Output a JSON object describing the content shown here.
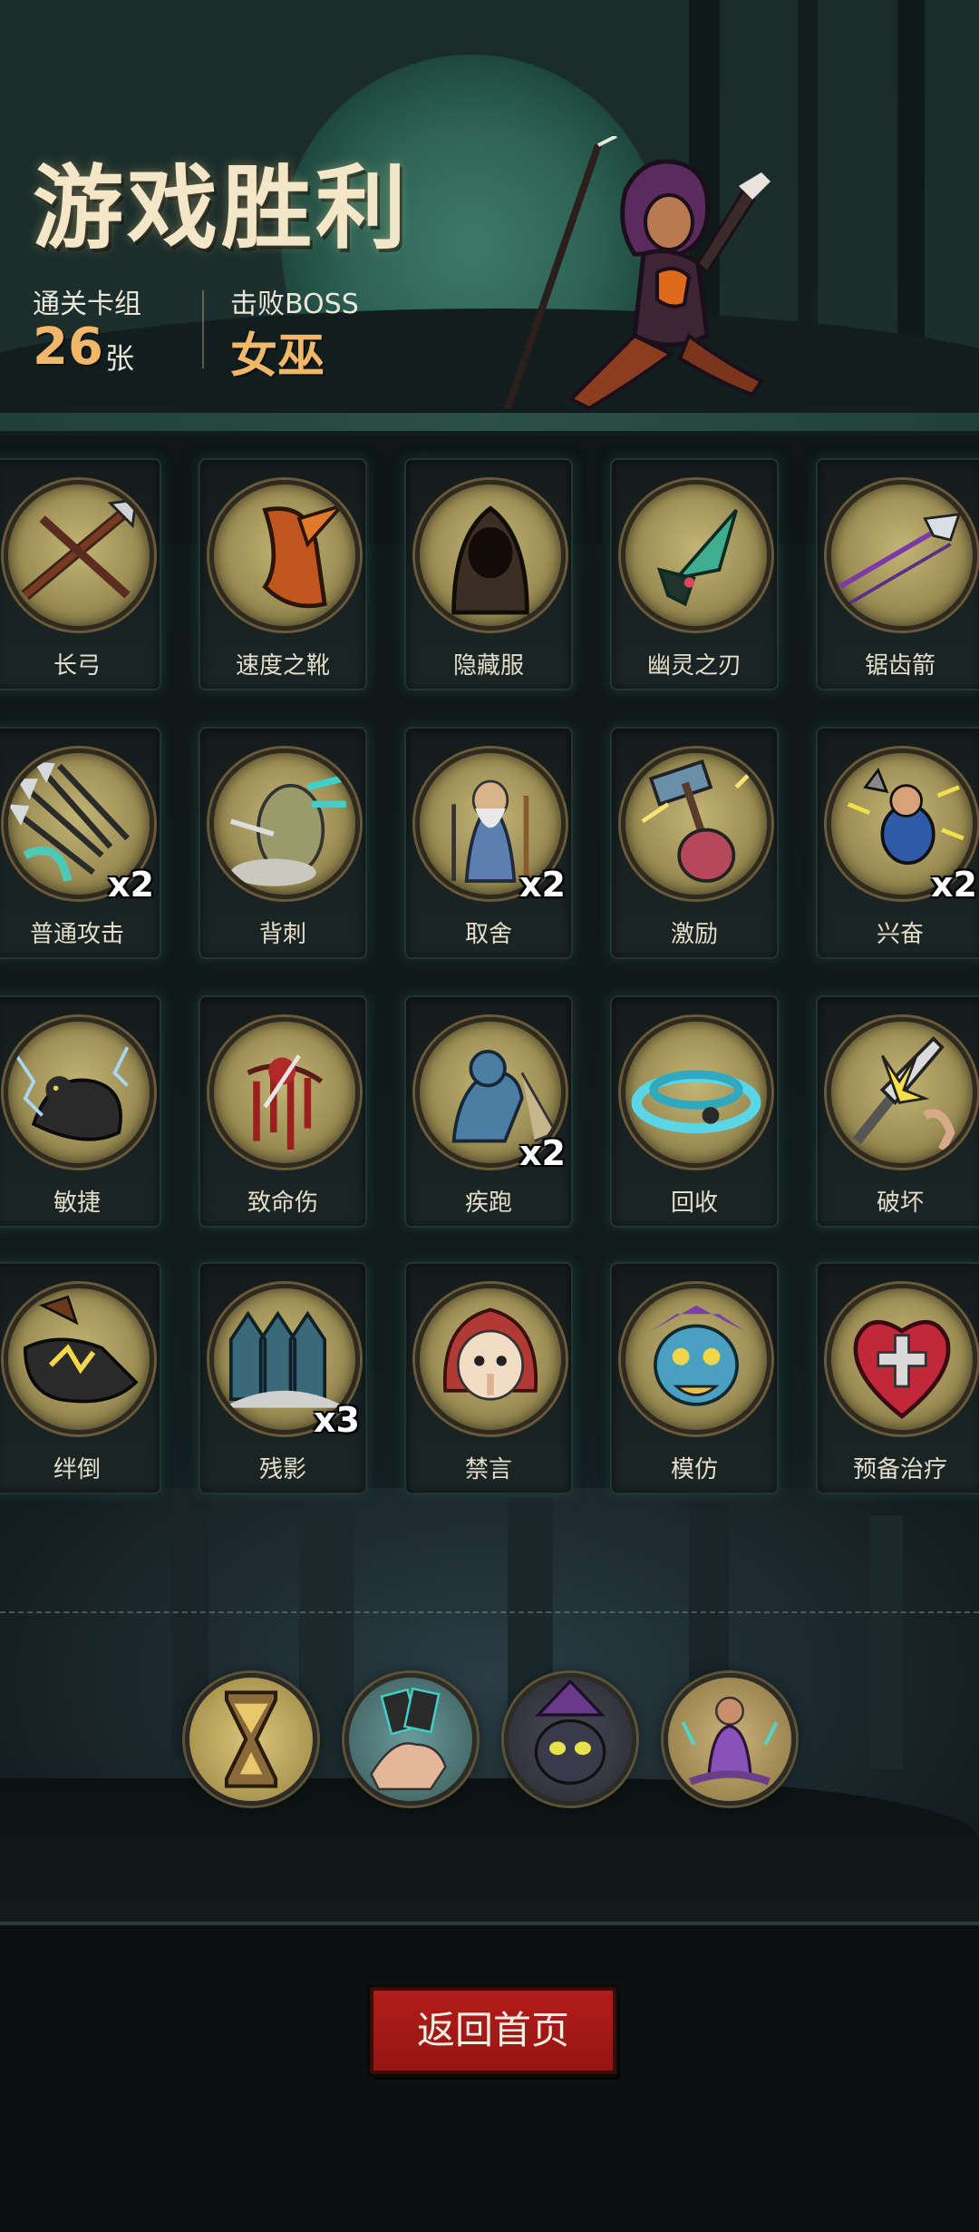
{
  "victory": {
    "title": "游戏胜利",
    "stats": {
      "cleared_label": "通关卡组",
      "cleared_value": "26",
      "cleared_unit": "张",
      "boss_label": "击败BOSS",
      "boss_value": "女巫"
    }
  },
  "cards": [
    {
      "label": "长弓",
      "icon": "longbow-icon"
    },
    {
      "label": "速度之靴",
      "icon": "speed-boots-icon"
    },
    {
      "label": "隐藏服",
      "icon": "hooded-cloak-icon"
    },
    {
      "label": "幽灵之刃",
      "icon": "ghost-blade-icon"
    },
    {
      "label": "锯齿箭",
      "icon": "serrated-arrow-icon"
    },
    {
      "label": "普通攻击",
      "icon": "arrows-volley-icon",
      "count": "x2"
    },
    {
      "label": "背刺",
      "icon": "backstab-icon"
    },
    {
      "label": "取舍",
      "icon": "old-sage-icon",
      "count": "x2"
    },
    {
      "label": "激励",
      "icon": "hammer-warrior-icon"
    },
    {
      "label": "兴奋",
      "icon": "excited-dwarf-icon",
      "count": "x2"
    },
    {
      "label": "敏捷",
      "icon": "panther-icon"
    },
    {
      "label": "致命伤",
      "icon": "bleeding-wound-icon"
    },
    {
      "label": "疾跑",
      "icon": "sprinting-beast-icon",
      "count": "x2"
    },
    {
      "label": "回收",
      "icon": "whirlwind-icon"
    },
    {
      "label": "破坏",
      "icon": "shattered-sword-icon"
    },
    {
      "label": "绊倒",
      "icon": "trip-boot-icon"
    },
    {
      "label": "残影",
      "icon": "afterimage-icon",
      "count": "x3"
    },
    {
      "label": "禁言",
      "icon": "hushed-girl-icon"
    },
    {
      "label": "模仿",
      "icon": "goblin-face-icon"
    },
    {
      "label": "预备治疗",
      "icon": "heart-cross-icon"
    }
  ],
  "relics": [
    {
      "icon": "hourglass-icon"
    },
    {
      "icon": "card-hand-icon"
    },
    {
      "icon": "witch-cat-icon"
    },
    {
      "icon": "meditating-girl-icon"
    }
  ],
  "buttons": {
    "home_label": "返回首页"
  },
  "colors": {
    "accent_gold": "#f2b86a",
    "button_red": "#b21d1a",
    "medal_olive": "#9d8f55"
  }
}
